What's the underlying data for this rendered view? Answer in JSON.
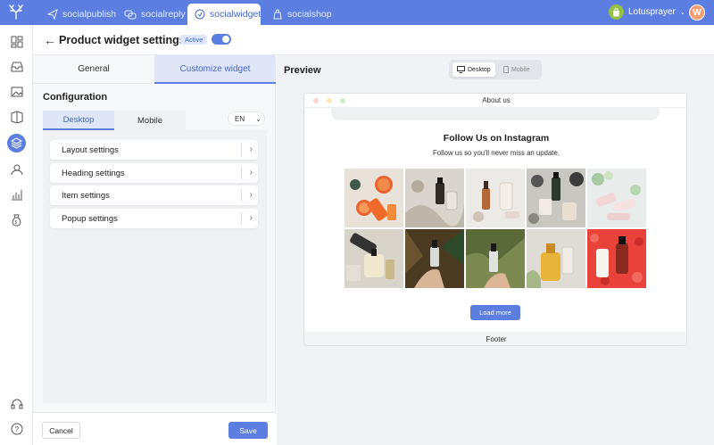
{
  "topbar": {
    "tabs": [
      {
        "label": "socialpublish",
        "icon": "paper-plane-icon"
      },
      {
        "label": "socialreply",
        "icon": "chat-bubbles-icon"
      },
      {
        "label": "socialwidget",
        "icon": "widget-icon"
      },
      {
        "label": "socialshop",
        "icon": "shopping-bag-icon"
      }
    ],
    "active_tab": "socialwidget",
    "shop_name": "Lotusprayer",
    "avatar_initial": "W",
    "accent_color": "#5b7ee0"
  },
  "sidebar": {
    "icons": [
      "dashboard-icon",
      "inbox-icon",
      "image-icon",
      "book-icon",
      "layers-icon",
      "user-icon",
      "bar-chart-icon",
      "money-bag-icon",
      "headset-icon",
      "help-icon"
    ],
    "active_icon": "layers-icon"
  },
  "header": {
    "back": "←",
    "title": "Product widget settings",
    "status_badge": "Active",
    "toggle_on": true
  },
  "left_panel": {
    "tabs": [
      "General",
      "Customize widget"
    ],
    "active_tab": "Customize widget",
    "config_title": "Configuration",
    "device_tabs": [
      "Desktop",
      "Mobile"
    ],
    "active_device": "Desktop",
    "language": "EN",
    "settings": [
      "Layout settings",
      "Heading settings",
      "Item settings",
      "Popup settings"
    ],
    "cancel_label": "Cancel",
    "save_label": "Save"
  },
  "preview": {
    "title": "Preview",
    "device_buttons": [
      "Desktop",
      "Mobile"
    ],
    "active_device": "Desktop",
    "page_header": "About us",
    "widget_title": "Follow Us on Instagram",
    "widget_subtitle": "Follow us so you'll never miss an update.",
    "load_more_label": "Load more",
    "page_footer": "Footer",
    "photo_count": 10
  }
}
